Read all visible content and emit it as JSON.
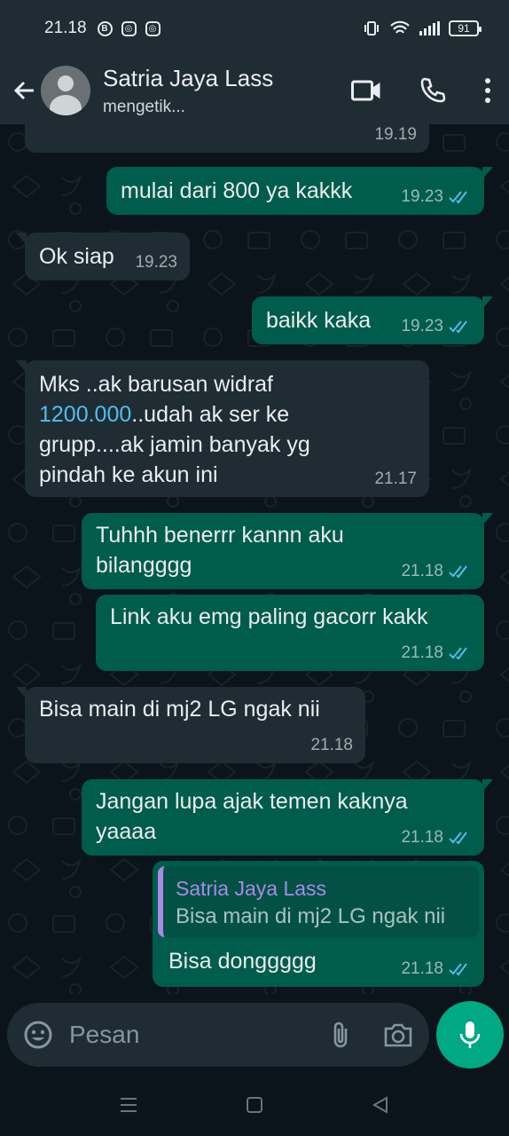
{
  "status_bar": {
    "time": "21.18",
    "battery": "91"
  },
  "header": {
    "name": "Satria Jaya Lass",
    "status": "mengetik..."
  },
  "messages": [
    {
      "id": 0,
      "dir": "in",
      "text": "",
      "time": "19.19"
    },
    {
      "id": 1,
      "dir": "out",
      "text": "mulai dari 800 ya kakkk",
      "time": "19.23",
      "read": true
    },
    {
      "id": 2,
      "dir": "in",
      "text": "Ok siap",
      "time": "19.23"
    },
    {
      "id": 3,
      "dir": "out",
      "text": "baikk kaka",
      "time": "19.23",
      "read": true
    },
    {
      "id": 4,
      "dir": "in",
      "line1": "Mks ..ak barusan widraf",
      "link": "1200.000",
      "line2": "..udah ak ser ke",
      "line3": "grupp....ak jamin banyak yg",
      "line4": "pindah ke akun ini",
      "time": "21.17"
    },
    {
      "id": 5,
      "dir": "out",
      "line1": "Tuhhh benerrr kannn aku",
      "line2": "bilangggg",
      "time": "21.18",
      "read": true
    },
    {
      "id": 6,
      "dir": "out",
      "text": "Link aku emg paling gacorr kakk",
      "time": "21.18",
      "read": true
    },
    {
      "id": 7,
      "dir": "in",
      "text": "Bisa main di mj2 LG ngak nii",
      "time": "21.18"
    },
    {
      "id": 8,
      "dir": "out",
      "line1": "Jangan lupa ajak temen kaknya",
      "line2": "yaaaa",
      "time": "21.18",
      "read": true
    },
    {
      "id": 9,
      "dir": "out",
      "quote_name": "Satria Jaya Lass",
      "quote_text": "Bisa main di mj2 LG ngak nii",
      "text": "Bisa donggggg",
      "time": "21.18",
      "read": true
    }
  ],
  "composer": {
    "placeholder": "Pesan"
  },
  "colors": {
    "incoming": "#1f2c34",
    "outgoing": "#005c4b",
    "accent": "#00a884",
    "read_ticks": "#53bdeb",
    "quote_name": "#a88ae8"
  },
  "icons": [
    "back-arrow-icon",
    "video-call-icon",
    "phone-icon",
    "more-icon",
    "emoji-icon",
    "attach-icon",
    "camera-icon",
    "mic-icon"
  ]
}
